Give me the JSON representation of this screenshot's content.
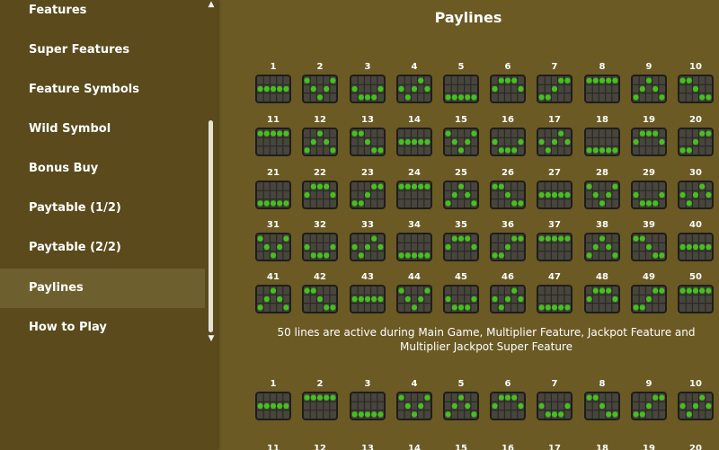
{
  "sidebar": {
    "items": [
      {
        "label": "Features",
        "active": false
      },
      {
        "label": "Super Features",
        "active": false
      },
      {
        "label": "Feature Symbols",
        "active": false
      },
      {
        "label": "Wild Symbol",
        "active": false
      },
      {
        "label": "Bonus Buy",
        "active": false
      },
      {
        "label": "Paytable (1/2)",
        "active": false
      },
      {
        "label": "Paytable (2/2)",
        "active": false
      },
      {
        "label": "Paylines",
        "active": true
      },
      {
        "label": "How to Play",
        "active": false
      }
    ]
  },
  "main": {
    "title": "Paylines",
    "note": "50 lines are active during Main Game, Multiplier Feature, Jackpot Feature and Multiplier Jackpot Super Feature",
    "section1_numbers": [
      "1",
      "2",
      "3",
      "4",
      "5",
      "6",
      "7",
      "8",
      "9",
      "10",
      "11",
      "12",
      "13",
      "14",
      "15",
      "16",
      "17",
      "18",
      "19",
      "20",
      "21",
      "22",
      "23",
      "24",
      "25",
      "26",
      "27",
      "28",
      "29",
      "30",
      "31",
      "32",
      "33",
      "34",
      "35",
      "36",
      "37",
      "38",
      "39",
      "40",
      "41",
      "42",
      "43",
      "44",
      "45",
      "46",
      "47",
      "48",
      "49",
      "50"
    ],
    "section2_numbers": [
      "1",
      "2",
      "3",
      "4",
      "5",
      "6",
      "7",
      "8",
      "9",
      "10"
    ],
    "section2_partial_numbers": [
      "11",
      "12",
      "13",
      "14",
      "15",
      "16",
      "17",
      "18",
      "19",
      "20"
    ]
  },
  "colors": {
    "sidebar_bg": "#5a4a1c",
    "main_bg": "#6b5a24",
    "active_item": "#6e5f2e",
    "dot": "#44c21c"
  }
}
